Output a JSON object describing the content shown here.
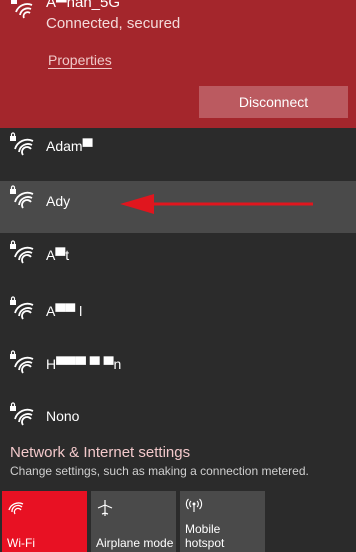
{
  "connected": {
    "name": "A▀nan_5G",
    "status": "Connected, secured",
    "properties_label": "Properties",
    "disconnect_label": "Disconnect",
    "accent_color": "#a4262c"
  },
  "networks": [
    {
      "name": "Adam▀",
      "secured": true
    },
    {
      "name": "Ady",
      "secured": true
    },
    {
      "name": "A▀t",
      "secured": true
    },
    {
      "name": "A▀▀ l",
      "secured": true
    },
    {
      "name": "H▀▀▀ ▀ ▀n",
      "secured": true
    },
    {
      "name": "Nono",
      "secured": true
    }
  ],
  "settings": {
    "title": "Network & Internet settings",
    "subtitle": "Change settings, such as making a connection metered."
  },
  "tiles": [
    {
      "label": "Wi-Fi",
      "icon": "wifi-icon",
      "active": true
    },
    {
      "label": "Airplane mode",
      "icon": "airplane-icon",
      "active": false
    },
    {
      "label_line1": "Mobile",
      "label_line2": "hotspot",
      "icon": "hotspot-icon",
      "active": false
    }
  ],
  "annotation": {
    "icon": "red-arrow-icon",
    "color": "#e0161e"
  }
}
